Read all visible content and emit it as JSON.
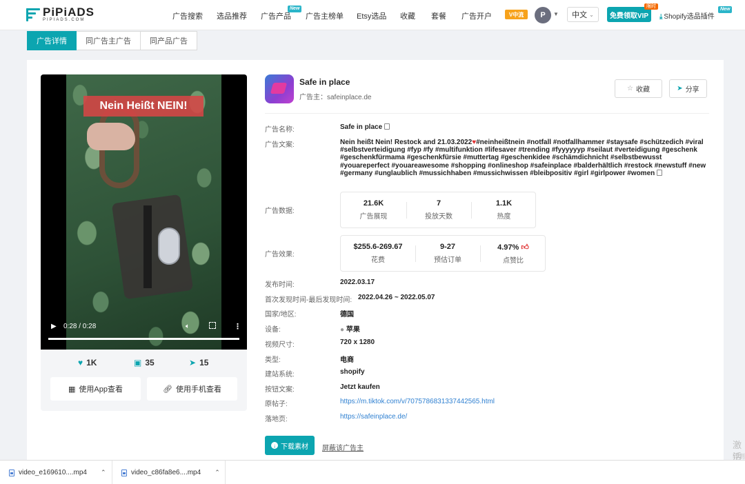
{
  "nav": {
    "logo_main": "PiPiADS",
    "logo_sub": "PIPIADS.COM",
    "items": [
      "广告搜索",
      "选品推荐",
      "广告产品",
      "广告主榜单",
      "Etsy选品",
      "收藏",
      "套餐",
      "广告开户"
    ],
    "new_badge": "New",
    "vip_logo": "V中流",
    "avatar_initial": "P",
    "lang": "中文",
    "vip_button": "免费领取VIP",
    "limit_badge": "限时",
    "plugin": "Shopify选品插件",
    "plugin_badge": "New"
  },
  "tabs": [
    "广告详情",
    "同广告主广告",
    "同产品广告"
  ],
  "video": {
    "caption": "Nein Heißt NEIN!",
    "time": "0:28 / 0:28",
    "progress": 1.0,
    "likes": "1K",
    "comments": "35",
    "shares": "15",
    "btn_app": "使用App查看",
    "btn_phone": "使用手机查看"
  },
  "app": {
    "name": "Safe in place",
    "advertiser_label": "广告主：",
    "advertiser": "safeinplace.de",
    "collect": "收藏",
    "share": "分享"
  },
  "details": {
    "ad_name_label": "广告名称:",
    "ad_name": "Safe in place",
    "ad_copy_label": "广告文案:",
    "ad_copy_head": "Nein heißt Nein! Restock and 21.03.2022",
    "ad_copy_body": "#neinheißtnein #notfall #notfallhammer #staysafe #schützedich #viral #selbstverteidigung #fyp #fy #multifunktion #lifesaver #trending #fyyyyyyp #seilaut #verteidigung #geschenk #geschenkfürmama #geschenkfürsie #muttertag #geschenkidee #schämdichnicht #selbstbewusst #youareperfect #youareawesome #shopping #onlineshop #safeinplace #balderhältlich #restock #newstuff #new #germany #unglaublich #mussichhaben #mussichwissen #bleibpositiv #girl #girlpower #women",
    "ad_data_label": "广告数据:",
    "ad_data": [
      {
        "value": "21.6K",
        "label": "广告展现"
      },
      {
        "value": "7",
        "label": "投放天数"
      },
      {
        "value": "1.1K",
        "label": "热度"
      }
    ],
    "ad_effect_label": "广告效果:",
    "ad_effect": [
      {
        "value": "$255.6-269.67",
        "label": "花费"
      },
      {
        "value": "9-27",
        "label": "预估订单"
      },
      {
        "value": "4.97%",
        "label": "点赞比"
      }
    ],
    "publish_label": "发布时间:",
    "publish": "2022.03.17",
    "seen_label": "首次发现时间-最后发现时间:",
    "seen": "2022.04.26 ~ 2022.05.07",
    "country_label": "国家/地区:",
    "country": "德国",
    "device_label": "设备:",
    "device": "苹果",
    "size_label": "视频尺寸:",
    "size": "720 x 1280",
    "type_label": "类型:",
    "type": "电商",
    "site_label": "建站系统:",
    "site": "shopify",
    "cta_label": "按钮文案:",
    "cta": "Jetzt kaufen",
    "post_label": "原帖子:",
    "post": "https://m.tiktok.com/v/7075786831337442565.html",
    "landing_label": "落地页:",
    "landing": "https://safeinplace.de/"
  },
  "actions": {
    "download": "下载素材",
    "block": "屏蔽该广告主"
  },
  "watermark": {
    "line1": "激活",
    "line2": "转到"
  },
  "downloads": [
    {
      "name": "video_e169610....mp4"
    },
    {
      "name": "video_c86fa8e6....mp4"
    }
  ],
  "colors": {
    "accent": "#0ca5b0",
    "link": "#2f80d1",
    "like": "#e03131"
  }
}
